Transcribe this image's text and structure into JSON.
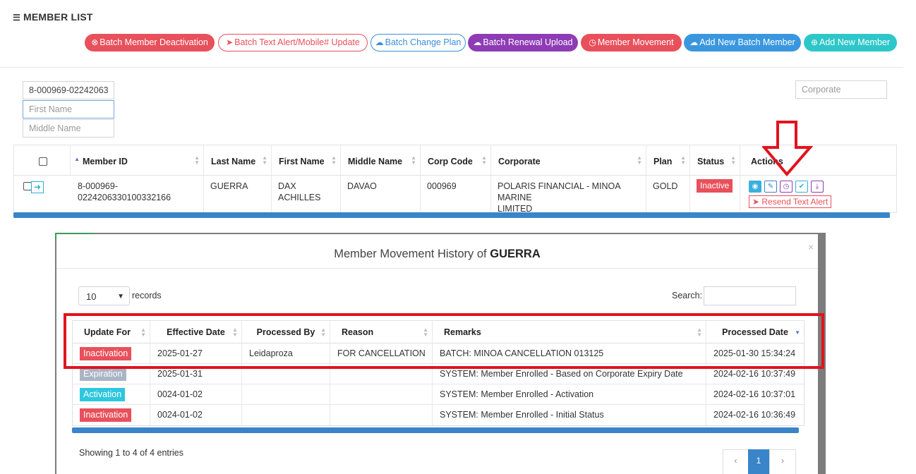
{
  "page": {
    "title": "MEMBER LIST"
  },
  "toolbar": {
    "batch_deactivation": "Batch Member Deactivation",
    "batch_text_alert": "Batch Text Alert/Mobile# Update",
    "batch_change_plan": "Batch Change Plan",
    "batch_renewal_upload": "Batch Renewal Upload",
    "member_movement": "Member Movement",
    "add_new_batch_member": "Add New Batch Member",
    "add_new_member": "Add New Member"
  },
  "filters": {
    "member_id_value": "8-000969-02242063",
    "first_name_placeholder": "First Name",
    "middle_name_placeholder": "Middle Name",
    "corporate_placeholder": "Corporate"
  },
  "members_table": {
    "headers": [
      "Member ID",
      "Last Name",
      "First Name",
      "Middle Name",
      "Corp Code",
      "Corporate",
      "Plan",
      "Status",
      "Actions"
    ],
    "rows": [
      {
        "member_id_line1": "8-000969-",
        "member_id_line2": "0224206330100332166",
        "last_name": "GUERRA",
        "first_name": "DAX ACHILLES",
        "middle_name": "DAVAO",
        "corp_code": "000969",
        "corporate_line1": "POLARIS FINANCIAL - MINOA MARINE",
        "corporate_line2": "LIMITED",
        "plan": "GOLD",
        "status": "Inactive",
        "resend_label": "Resend Text Alert"
      }
    ]
  },
  "modal": {
    "title_prefix": "Member Movement History of",
    "title_name": "GUERRA",
    "page_size": "10",
    "records_label": "records",
    "search_label": "Search:",
    "headers": [
      "Update For",
      "Effective Date",
      "Processed By",
      "Reason",
      "Remarks",
      "Processed Date"
    ],
    "rows": [
      {
        "update_for": "Inactivation",
        "effective_date": "2025-01-27",
        "processed_by": "Leidaproza",
        "reason": "FOR CANCELLATION",
        "remarks": "BATCH: MINOA CANCELLATION 013125",
        "processed_date": "2025-01-30 15:34:24"
      },
      {
        "update_for": "Expiration",
        "effective_date": "2025-01-31",
        "processed_by": "",
        "reason": "",
        "remarks": "SYSTEM: Member Enrolled - Based on Corporate Expiry Date",
        "processed_date": "2024-02-16 10:37:49"
      },
      {
        "update_for": "Activation",
        "effective_date": "0024-01-02",
        "processed_by": "",
        "reason": "",
        "remarks": "SYSTEM: Member Enrolled - Activation",
        "processed_date": "2024-02-16 10:37:01"
      },
      {
        "update_for": "Inactivation",
        "effective_date": "0024-01-02",
        "processed_by": "",
        "reason": "",
        "remarks": "SYSTEM: Member Enrolled - Initial Status",
        "processed_date": "2024-02-16 10:36:49"
      }
    ],
    "showing": "Showing 1 to 4 of 4 entries",
    "current_page": "1"
  }
}
